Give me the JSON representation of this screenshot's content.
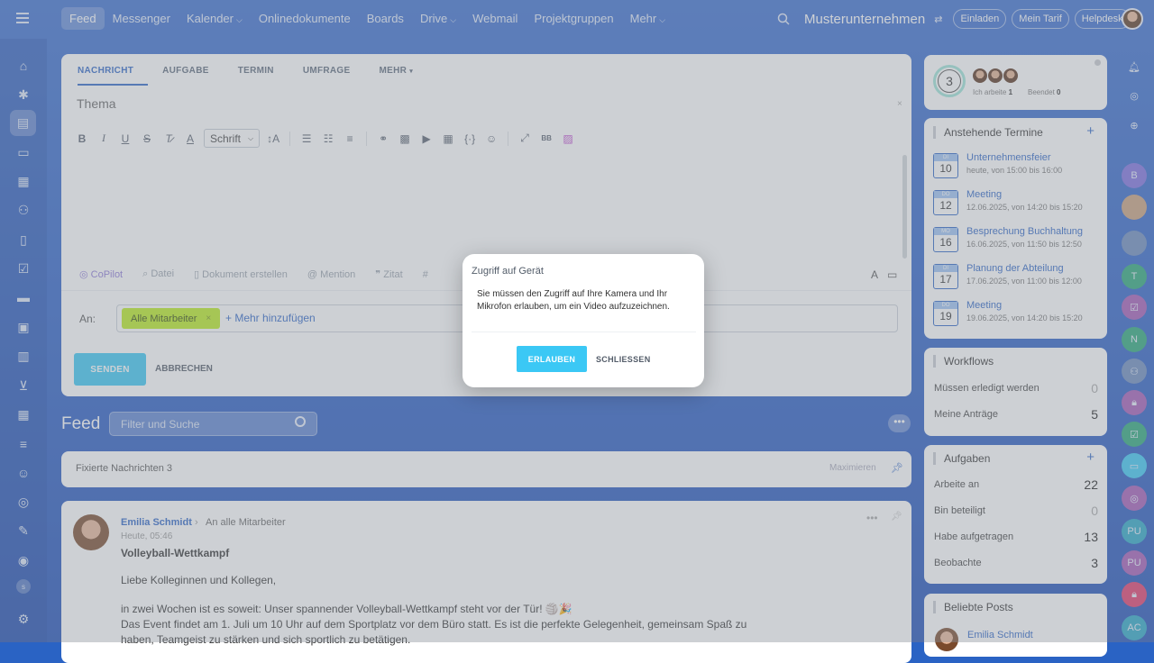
{
  "topnav": {
    "items": [
      {
        "label": "Feed",
        "active": true,
        "dropdown": false
      },
      {
        "label": "Messenger",
        "dropdown": false
      },
      {
        "label": "Kalender",
        "dropdown": true
      },
      {
        "label": "Onlinedokumente",
        "dropdown": false
      },
      {
        "label": "Boards",
        "dropdown": false
      },
      {
        "label": "Drive",
        "dropdown": true
      },
      {
        "label": "Webmail",
        "dropdown": false
      },
      {
        "label": "Projektgruppen",
        "dropdown": false
      },
      {
        "label": "Mehr",
        "dropdown": true
      }
    ],
    "company": "Musterunternehmen",
    "buttons": {
      "invite": "Einladen",
      "plan": "Mein Tarif",
      "helpdesk": "Helpdesk"
    }
  },
  "sidebar_left": {
    "icons": [
      "home-icon",
      "sparkle-icon",
      "feed-icon",
      "chat-icon",
      "calendar-icon",
      "people-icon",
      "document-icon",
      "tasks-icon",
      "crm-icon",
      "board-icon",
      "analytics-icon",
      "shop-icon",
      "planner-icon",
      "filter-icon",
      "robot-icon",
      "target-icon",
      "sign-icon",
      "support-icon",
      "user-badge-icon",
      "settings-icon"
    ],
    "badge_label": "s"
  },
  "sidebar_right": {
    "avatars": [
      "T",
      "N",
      "PU",
      "PU",
      "AC"
    ]
  },
  "composer": {
    "tabs": [
      "NACHRICHT",
      "AUFGABE",
      "TERMIN",
      "UMFRAGE",
      "MEHR"
    ],
    "subject_placeholder": "Thema",
    "font_select": "Schrift",
    "bottom_tools": {
      "copilot": "CoPilot",
      "file": "Datei",
      "doc": "Dokument erstellen",
      "mention": "Mention",
      "quote": "Zitat"
    },
    "to_label": "An:",
    "recipient": "Alle Mitarbeiter",
    "add_more": "+ Mehr hinzufügen",
    "send": "SENDEN",
    "cancel": "ABBRECHEN"
  },
  "feed": {
    "title": "Feed",
    "search_placeholder": "Filter und Suche",
    "pinned": {
      "label": "Fixierte Nachrichten",
      "count": "3",
      "maximize": "Maximieren"
    },
    "post": {
      "author": "Emilia Schmidt",
      "recipients": "An alle Mitarbeiter",
      "time": "Heute, 05:46",
      "title": "Volleyball-Wettkampf",
      "greeting": "Liebe Kolleginnen und Kollegen,",
      "line1": "in zwei Wochen ist es soweit: Unser spannender Volleyball-Wettkampf steht vor der Tür! 🏐🎉",
      "line2": "Das Event findet am 1. Juli um 10 Uhr auf dem Sportplatz vor dem Büro statt. Es ist die perfekte Gelegenheit, gemeinsam Spaß zu",
      "line3": "haben, Teamgeist zu stärken und sich sportlich zu betätigen."
    }
  },
  "worktime": {
    "count": "3",
    "working_label": "Ich arbeite",
    "working_count": "1",
    "finished_label": "Beendet",
    "finished_count": "0"
  },
  "events": {
    "title": "Anstehende Termine",
    "items": [
      {
        "weekday": "DI",
        "day": "10",
        "name": "Unternehmensfeier",
        "when": "heute, von 15:00 bis 16:00"
      },
      {
        "weekday": "DO",
        "day": "12",
        "name": "Meeting",
        "when": "12.06.2025, von 14:20 bis 15:20"
      },
      {
        "weekday": "MO",
        "day": "16",
        "name": "Besprechung Buchhaltung",
        "when": "16.06.2025, von 11:50 bis 12:50"
      },
      {
        "weekday": "DI",
        "day": "17",
        "name": "Planung der Abteilung",
        "when": "17.06.2025, von 11:00 bis 12:00"
      },
      {
        "weekday": "DO",
        "day": "19",
        "name": "Meeting",
        "when": "19.06.2025, von 14:20 bis 15:20"
      }
    ]
  },
  "workflows": {
    "title": "Workflows",
    "rows": [
      {
        "label": "Müssen erledigt werden",
        "value": "0"
      },
      {
        "label": "Meine Anträge",
        "value": "5"
      }
    ]
  },
  "tasks": {
    "title": "Aufgaben",
    "rows": [
      {
        "label": "Arbeite an",
        "value": "22"
      },
      {
        "label": "Bin beteiligt",
        "value": "0"
      },
      {
        "label": "Habe aufgetragen",
        "value": "13"
      },
      {
        "label": "Beobachte",
        "value": "3"
      }
    ]
  },
  "popular": {
    "title": "Beliebte Posts",
    "author": "Emilia Schmidt"
  },
  "dialog": {
    "title": "Zugriff auf Gerät",
    "message": "Sie müssen den Zugriff auf Ihre Kamera und Ihr Mikrofon erlauben, um ein Video aufzuzeichnen.",
    "allow": "ERLAUBEN",
    "close": "SCHLIESSEN"
  }
}
